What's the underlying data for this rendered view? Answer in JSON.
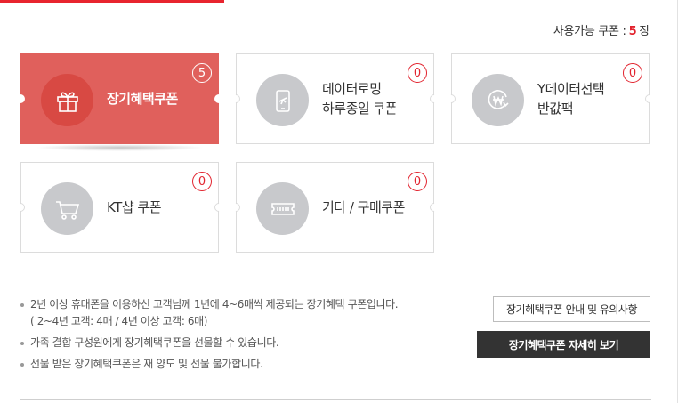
{
  "summary": {
    "label": "사용가능 쿠폰 :",
    "count": "5",
    "unit": "장"
  },
  "colors": {
    "accent": "#e2232e",
    "active_card": "#e0605c",
    "icon_circle": "#c8c9cc",
    "primary_button": "#333333"
  },
  "coupons": [
    {
      "label": "장기혜택쿠폰",
      "count": "5",
      "icon": "gift-icon",
      "active": true
    },
    {
      "label": "데이터로밍\n하루종일 쿠폰",
      "count": "0",
      "icon": "phone-airplane-icon",
      "active": false
    },
    {
      "label": "Y데이터선택\n반값팩",
      "count": "0",
      "icon": "won-refresh-icon",
      "active": false
    },
    {
      "label": "KT샵 쿠폰",
      "count": "0",
      "icon": "shopping-cart-icon",
      "active": false
    },
    {
      "label": "기타 / 구매쿠폰",
      "count": "0",
      "icon": "ticket-icon",
      "active": false
    }
  ],
  "notes": {
    "line1": "2년 이상 휴대폰을 이용하신 고객님께 1년에 4~6매씩 제공되는 장기혜택 쿠폰입니다.",
    "line1_sub": "( 2~4년 고객: 4매 / 4년 이상 고객: 6매)",
    "line2": "가족 결합 구성원에게 장기혜택쿠폰을 선물할 수 있습니다.",
    "line3": "선물 받은 장기혜택쿠폰은 재 양도 및 선물 불가합니다."
  },
  "buttons": {
    "info": "장기혜택쿠폰 안내 및 유의사항",
    "detail": "장기혜택쿠폰 자세히 보기"
  }
}
